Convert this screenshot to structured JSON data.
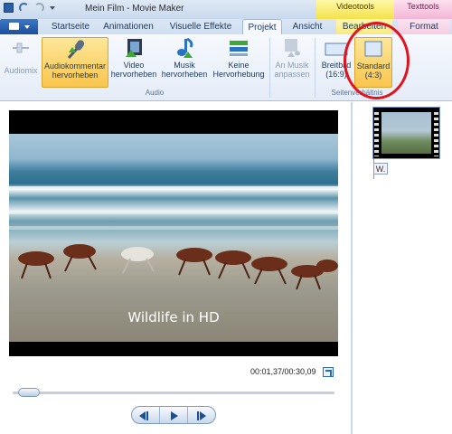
{
  "window": {
    "title": "Mein Film - Movie Maker",
    "context_tabs": {
      "video_tools": "Videotools",
      "text_tools": "Texttools"
    }
  },
  "tabs": [
    {
      "label": "Startseite"
    },
    {
      "label": "Animationen"
    },
    {
      "label": "Visuelle Effekte"
    },
    {
      "label": "Projekt",
      "active": true
    },
    {
      "label": "Ansicht"
    },
    {
      "label": "Bearbeiten"
    },
    {
      "label": "Format"
    }
  ],
  "ribbon": {
    "audiomix": "Audiomix",
    "audio_group": {
      "label": "Audio",
      "buttons": [
        {
          "label1": "Audiokommentar",
          "label2": "hervorheben",
          "selected": true
        },
        {
          "label1": "Video",
          "label2": "hervorheben"
        },
        {
          "label1": "Musik",
          "label2": "hervorheben"
        },
        {
          "label1": "Keine",
          "label2": "Hervorhebung"
        }
      ]
    },
    "fit_music": {
      "label1": "An Musik",
      "label2": "anpassen"
    },
    "aspect_group": {
      "label": "Seitenverhältnis",
      "widescreen": {
        "label1": "Breitbild",
        "label2": "(16:9)"
      },
      "standard": {
        "label1": "Standard",
        "label2": "(4:3)",
        "selected": true
      }
    }
  },
  "preview": {
    "subtitle": "Wildlife in HD",
    "timecode": "00:01,37/00:30,09",
    "seek_position": 0.05
  },
  "storyboard": {
    "caption_chip": "W."
  },
  "colors": {
    "highlight_circle": "#e0141e",
    "selected_button": "#f9c54d",
    "video_tools_context": "#f4e14a",
    "text_tools_context": "#f3b6d6"
  }
}
